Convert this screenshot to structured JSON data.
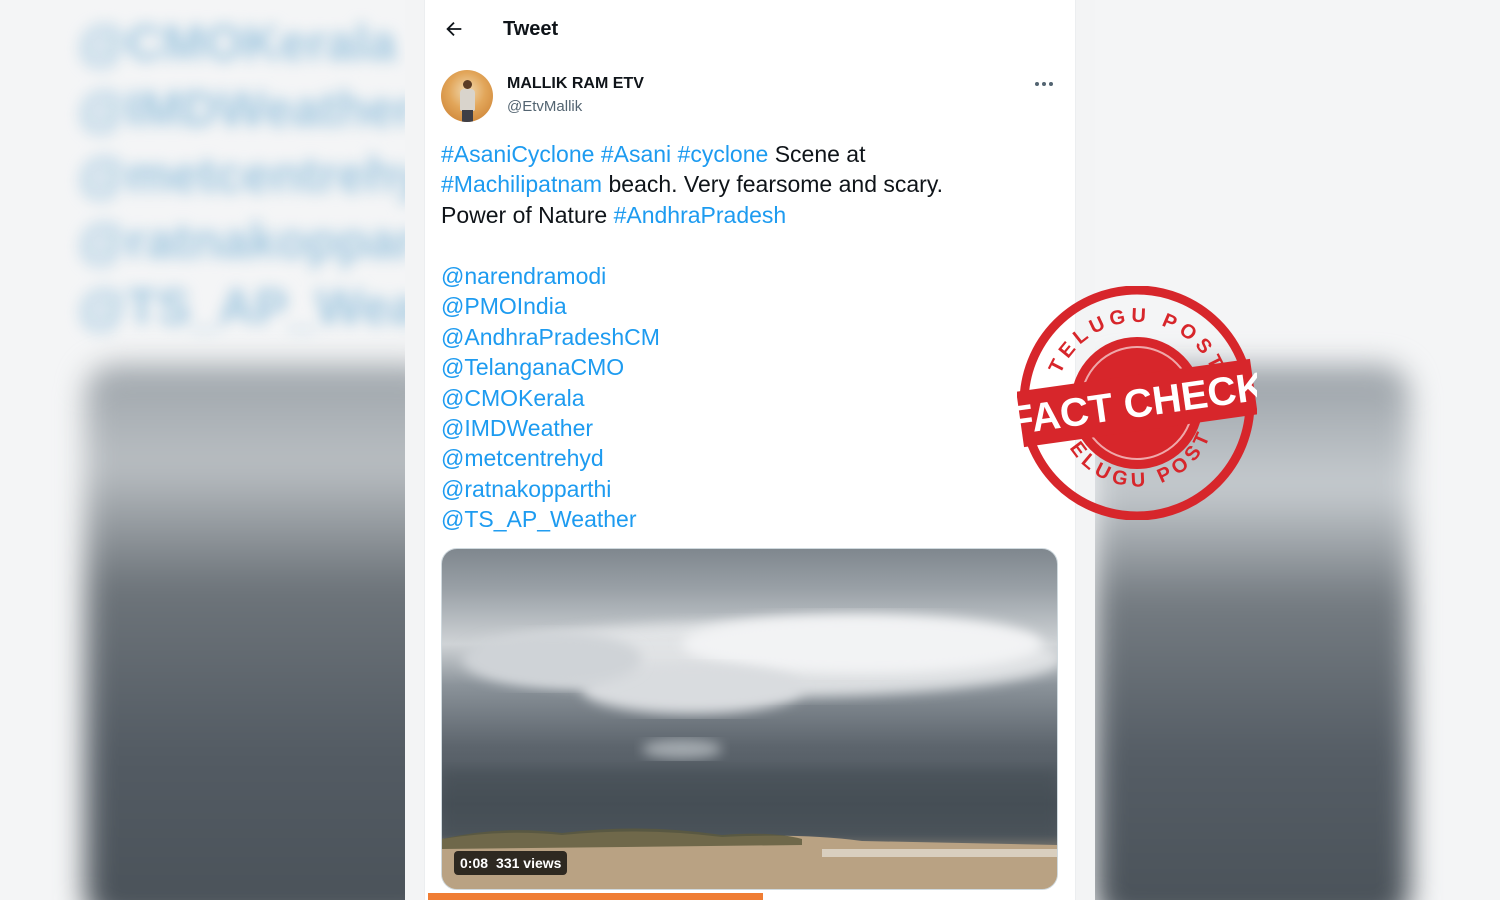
{
  "background": {
    "blurred_handles": [
      "@CMOKerala",
      "@IMDWeather",
      "@metcentrehyd",
      "@ratnakopparthi",
      "@TS_AP_Weather"
    ]
  },
  "header": {
    "title": "Tweet",
    "back_icon": "arrow-left-icon"
  },
  "tweet": {
    "author_name": "MALLIK RAM ETV",
    "author_handle": "@EtvMallik",
    "more_icon": "ellipsis-icon",
    "text_parts": {
      "tag1": "#AsaniCyclone",
      "tag2": "#Asani",
      "tag3": "#cyclone",
      "plain1": " Scene at",
      "tag4": "#Machilipatnam",
      "plain2": " beach. Very fearsome and scary.",
      "plain3": "Power of Nature ",
      "tag5": "#AndhraPradesh"
    },
    "mentions": [
      "@narendramodi",
      "@PMOIndia",
      "@AndhraPradeshCM",
      "@TelanganaCMO",
      "@CMOKerala",
      "@IMDWeather",
      "@metcentrehyd",
      "@ratnakopparthi",
      "@TS_AP_Weather"
    ],
    "media": {
      "duration": "0:08",
      "views": "331 views",
      "progress": 0.53
    }
  },
  "stamp": {
    "top_text": "TELUGU POST",
    "main_text": "FACT CHECK",
    "bottom_text": "TELUGU POST",
    "color": "#d7262b"
  },
  "colors": {
    "link": "#1d9bf0",
    "text": "#0f1419",
    "muted": "#536471",
    "progress": "#f07d34"
  }
}
